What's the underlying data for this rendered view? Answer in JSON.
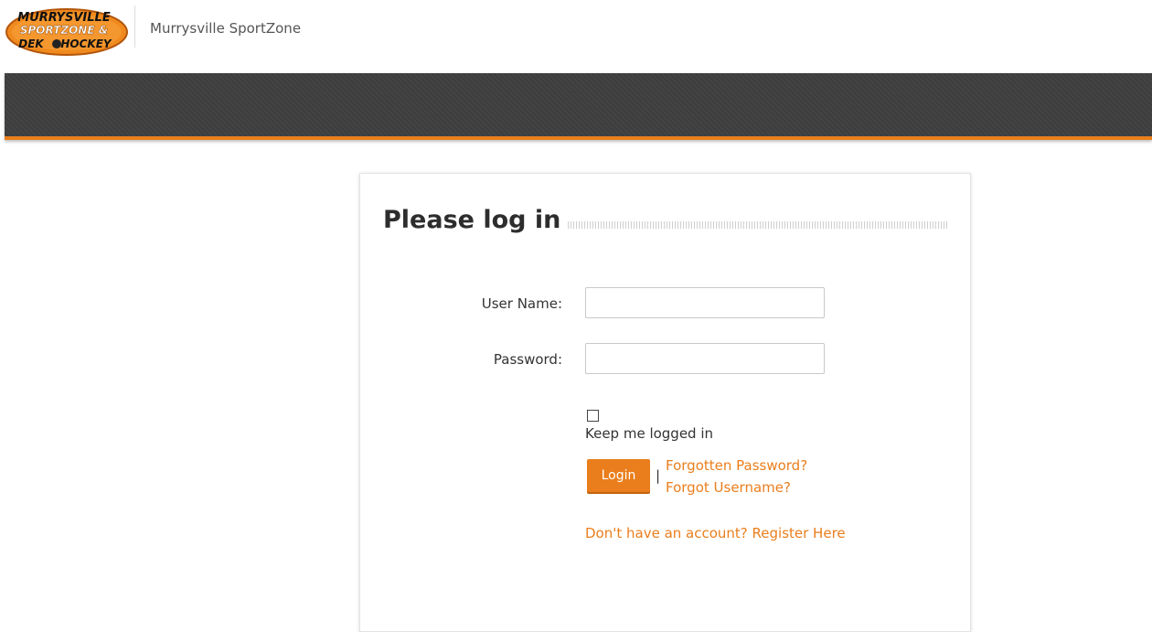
{
  "header": {
    "site_name": "Murrysville SportZone",
    "logo": {
      "line1": "MURRYSVILLE",
      "line2": "SPORTZONE &",
      "line3a": "DEK",
      "line3b": "HOCKEY"
    }
  },
  "colors": {
    "accent": "#ea7e1c",
    "navbar": "#3f3f3f"
  },
  "login": {
    "title": "Please log in",
    "username_label": "User Name:",
    "username_value": "",
    "password_label": "Password:",
    "password_value": "",
    "keep_logged_in_label": "Keep me logged in",
    "login_button": "Login",
    "separator": "|",
    "forgot_password": "Forgotten Password?",
    "forgot_username": "Forgot Username?",
    "register": "Don't have an account? Register Here"
  }
}
